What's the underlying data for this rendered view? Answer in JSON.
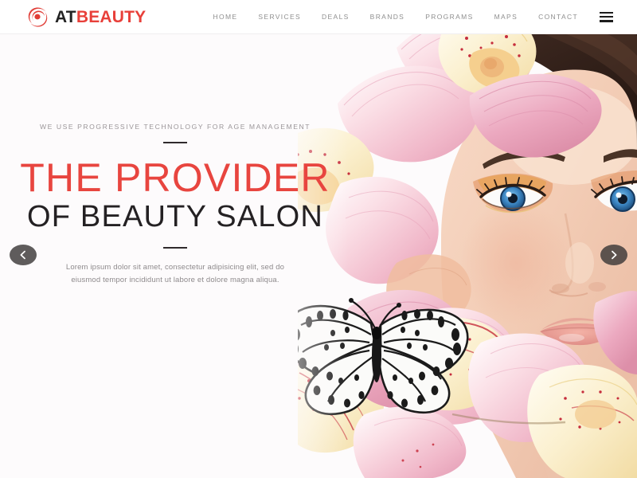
{
  "site": {
    "brand_primary_color": "#e8403a",
    "brand_dark_color": "#232323",
    "background_color": "#fdfbfc"
  },
  "header": {
    "logo_icon": "swirl-comet-logo-icon",
    "brand_name_part1": "AT",
    "brand_name_part2": "BEAUTY",
    "menu_icon": "hamburger-menu-icon",
    "nav": [
      {
        "label": "HOME"
      },
      {
        "label": "SERVICES"
      },
      {
        "label": "DEALS"
      },
      {
        "label": "BRANDS"
      },
      {
        "label": "PROGRAMS"
      },
      {
        "label": "MAPS"
      },
      {
        "label": "CONTACT"
      }
    ]
  },
  "hero": {
    "eyebrow": "WE USE PROGRESSIVE TECHNOLOGY FOR AGE MANAGEMENT",
    "headline_line1": "THE PROVIDER",
    "headline_line2": "OF BEAUTY SALON",
    "headline_line1_color": "#e8453f",
    "headline_line2_color": "#242123",
    "description": "Lorem ipsum dolor sit amet, consectetur adipisicing elit, sed do eiusmod tempor incididunt ut labore et dolore magna aliqua.",
    "image_alt": "Beauty model with pink orchid flowers in her hair and a black and white butterfly",
    "prev_icon": "chevron-left-icon",
    "next_icon": "chevron-right-icon"
  }
}
